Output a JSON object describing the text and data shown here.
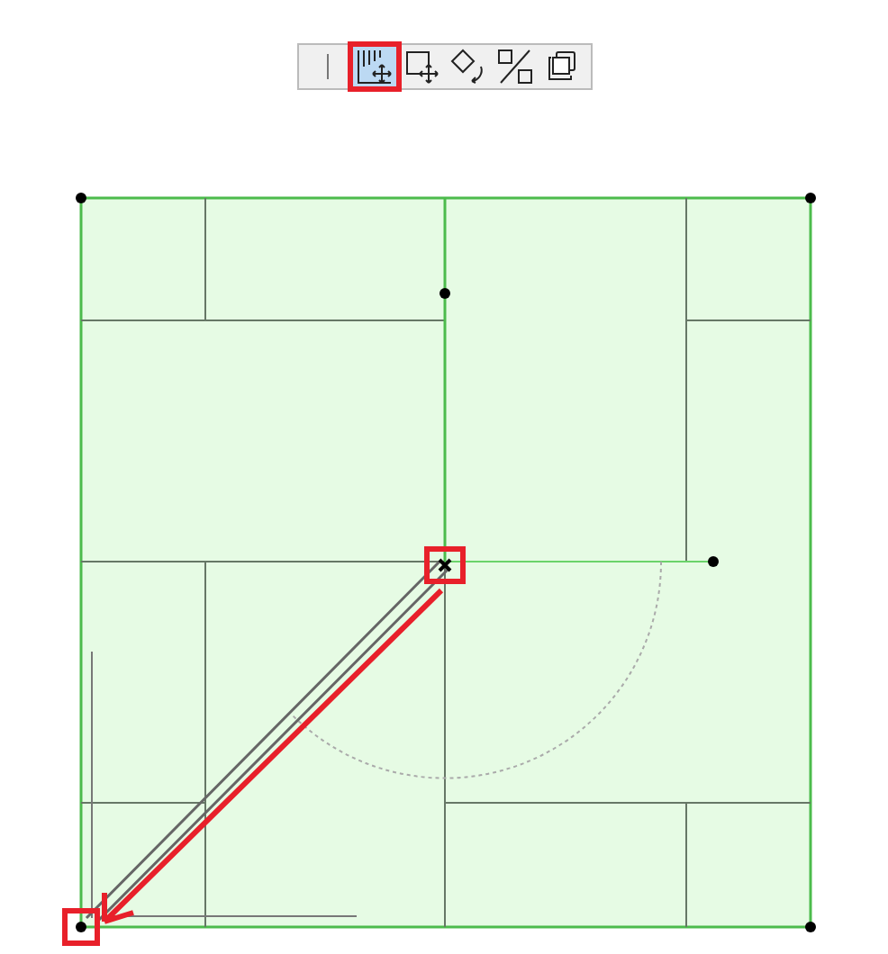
{
  "toolbar": {
    "buttons": [
      {
        "kind": "separator",
        "selected": false
      },
      {
        "kind": "stretch",
        "selected": true
      },
      {
        "kind": "move",
        "selected": false
      },
      {
        "kind": "rotate",
        "selected": false
      },
      {
        "kind": "mirror",
        "selected": false
      },
      {
        "kind": "copy",
        "selected": false
      }
    ]
  }
}
